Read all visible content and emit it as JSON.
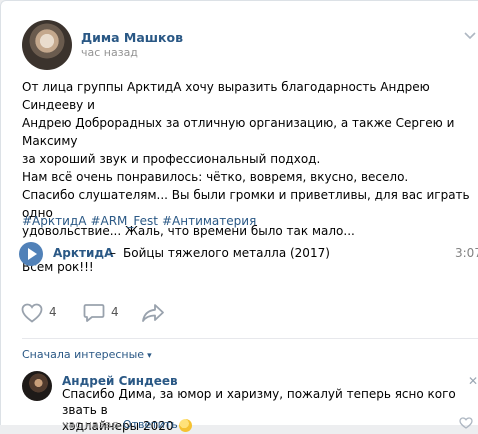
{
  "post": {
    "author": "Дима Машков",
    "time": "час назад",
    "lines": [
      "От лица группы АрктидА хочу выразить благодарность Андрею Синдееву и",
      "Андрею Доброрадных за отличную организацию, а также Сергею и Максиму",
      "за хороший звук и профессиональный подход.",
      "Нам всё очень понравилось: чётко, вовремя, вкусно, весело.",
      "Спасибо слушателям... Вы были громки и приветливы, для вас играть одно",
      "удовольствие... Жаль, что времени было так мало...",
      "Всем рок!!!"
    ],
    "hashtags": [
      "#АрктидА",
      "#ARM_Fest",
      "#Антиматерия"
    ],
    "audio": {
      "artist": "АрктидА",
      "separator": "–",
      "title": "Бойцы тяжелого металла (2017)",
      "duration": "3:07"
    },
    "likes": "4",
    "comments": "4"
  },
  "comments_section": {
    "sort_label": "Сначала интересные",
    "comment": {
      "author": "Андрей Синдеев",
      "line1": "Спасибо Дима, за юмор и харизму, пожалуй теперь ясно кого звать в",
      "line2": "хэдлайнеры 2020",
      "time": "час назад",
      "reply": "Ответить"
    }
  },
  "colors": {
    "link": "#2a5885",
    "play_button": "#5181b8",
    "muted": "#939393"
  },
  "icons": [
    "chevron-down-icon",
    "play-icon",
    "heart-icon",
    "comment-icon",
    "share-icon",
    "close-icon",
    "smile-emoji"
  ]
}
